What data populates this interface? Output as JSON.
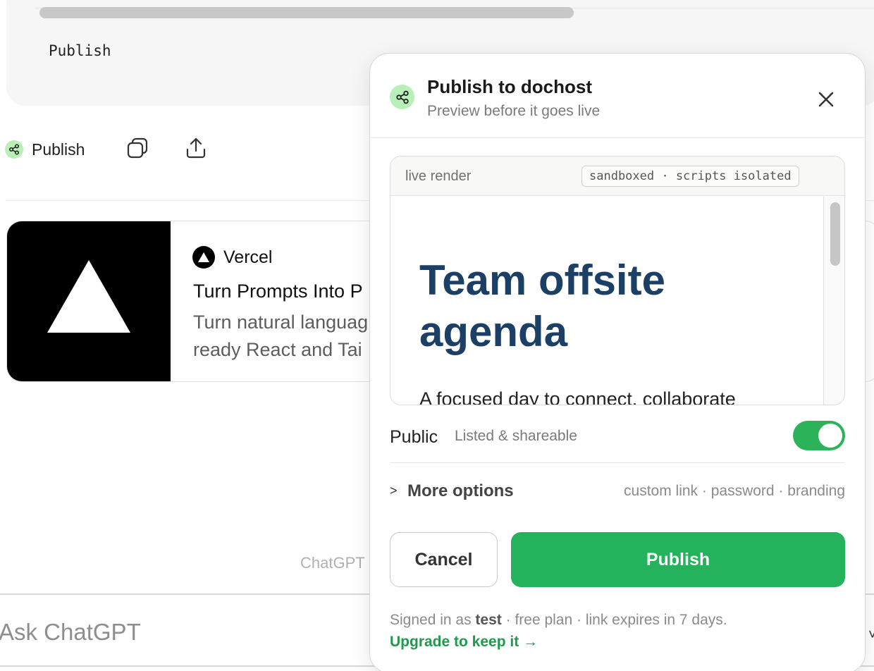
{
  "code_block": {
    "text": "Publish"
  },
  "actions": {
    "publish_label": "Publish"
  },
  "card": {
    "brand": "Vercel",
    "title": "Turn Prompts Into P",
    "description_line1": "Turn natural languag",
    "description_line2": "ready React and Tai"
  },
  "footer_note": "ChatGPT",
  "composer": {
    "placeholder": "Ask ChatGPT",
    "edge_glyph": "˅"
  },
  "modal": {
    "title": "Publish to dochost",
    "subtitle": "Preview before it goes live",
    "preview": {
      "label": "live render",
      "badge": "sandboxed · scripts isolated",
      "doc_title": "Team offsite agenda",
      "doc_lead": "A focused day to connect, collaborate"
    },
    "visibility": {
      "label": "Public",
      "sub": "Listed & shareable",
      "enabled": true
    },
    "more_options": {
      "chevron": ">",
      "label": "More options",
      "hint": "custom link · password · branding"
    },
    "buttons": {
      "cancel": "Cancel",
      "publish": "Publish"
    },
    "footer": {
      "prefix": "Signed in as ",
      "user": "test",
      "suffix": " · free plan · link expires in 7 days.",
      "upgrade": "Upgrade to keep it →"
    }
  },
  "colors": {
    "accent_green": "#24b35c",
    "logo_green_bg": "#b8f0b8",
    "doc_title_blue": "#1c3f66",
    "upgrade_link": "#1f9a4d"
  }
}
